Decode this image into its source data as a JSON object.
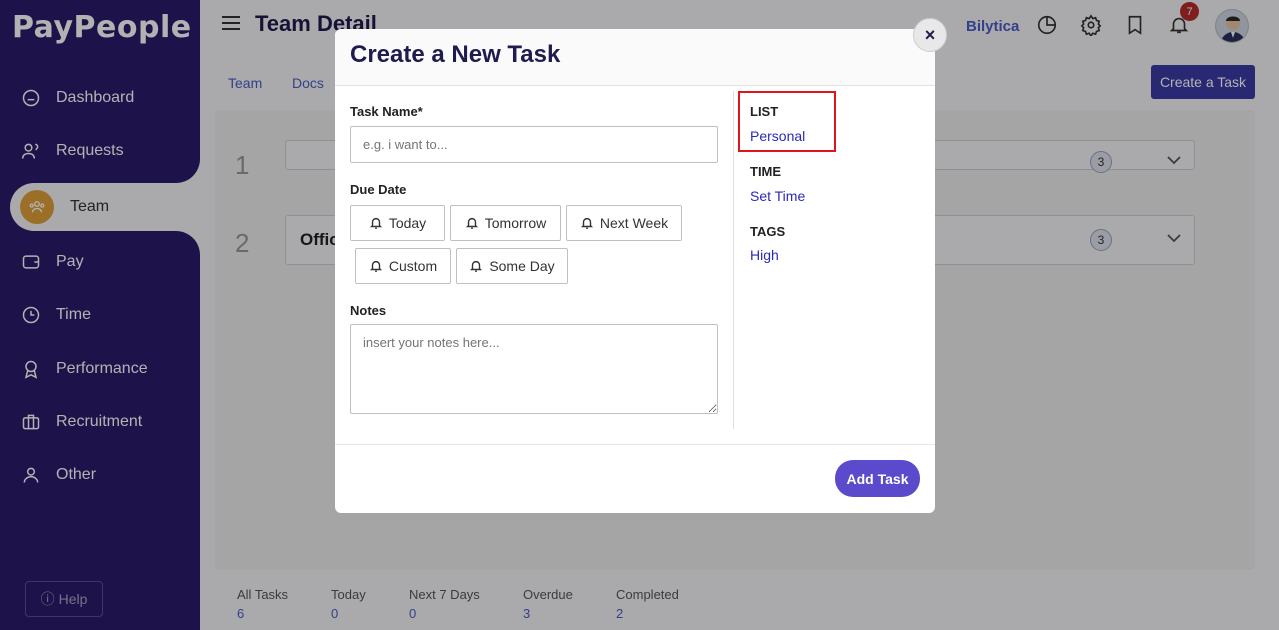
{
  "app": {
    "logo": "PayPeople"
  },
  "sidebar": {
    "items": [
      {
        "label": "Dashboard",
        "icon": "dashboard-icon"
      },
      {
        "label": "Requests",
        "icon": "requests-icon"
      },
      {
        "label": "Team",
        "icon": "team-icon",
        "active": true
      },
      {
        "label": "Pay",
        "icon": "wallet-icon"
      },
      {
        "label": "Time",
        "icon": "clock-icon"
      },
      {
        "label": "Performance",
        "icon": "award-icon"
      },
      {
        "label": "Recruitment",
        "icon": "briefcase-icon"
      },
      {
        "label": "Other",
        "icon": "user-icon"
      }
    ],
    "help": "Help"
  },
  "header": {
    "title": "Team Detail",
    "company": "Bilytica",
    "notification_count": "7"
  },
  "subnav": {
    "team": "Team",
    "docs": "Docs",
    "create_task": "Create a Task"
  },
  "rows": [
    {
      "num": "1",
      "label": "",
      "count": "3"
    },
    {
      "num": "2",
      "label": "Offic",
      "count": "3"
    }
  ],
  "stats": [
    {
      "label": "All Tasks",
      "value": "6"
    },
    {
      "label": "Today",
      "value": "0"
    },
    {
      "label": "Next 7 Days",
      "value": "0"
    },
    {
      "label": "Overdue",
      "value": "3"
    },
    {
      "label": "Completed",
      "value": "2"
    }
  ],
  "modal": {
    "title": "Create a New Task",
    "close": "×",
    "task_name_label": "Task Name*",
    "task_name_placeholder": "e.g. i want to...",
    "due_date_label": "Due Date",
    "due_options": [
      "Today",
      "Tomorrow",
      "Next Week",
      "Custom",
      "Some Day"
    ],
    "notes_label": "Notes",
    "notes_placeholder": "insert your notes here...",
    "list_label": "LIST",
    "list_value": "Personal",
    "time_label": "TIME",
    "time_value": "Set Time",
    "tags_label": "TAGS",
    "tags_value": "High",
    "add_button": "Add Task"
  },
  "colors": {
    "sidebar": "#2a1c6b",
    "accent": "#5b4acb",
    "link": "#2a2ab5",
    "highlight": "#e0141b"
  }
}
